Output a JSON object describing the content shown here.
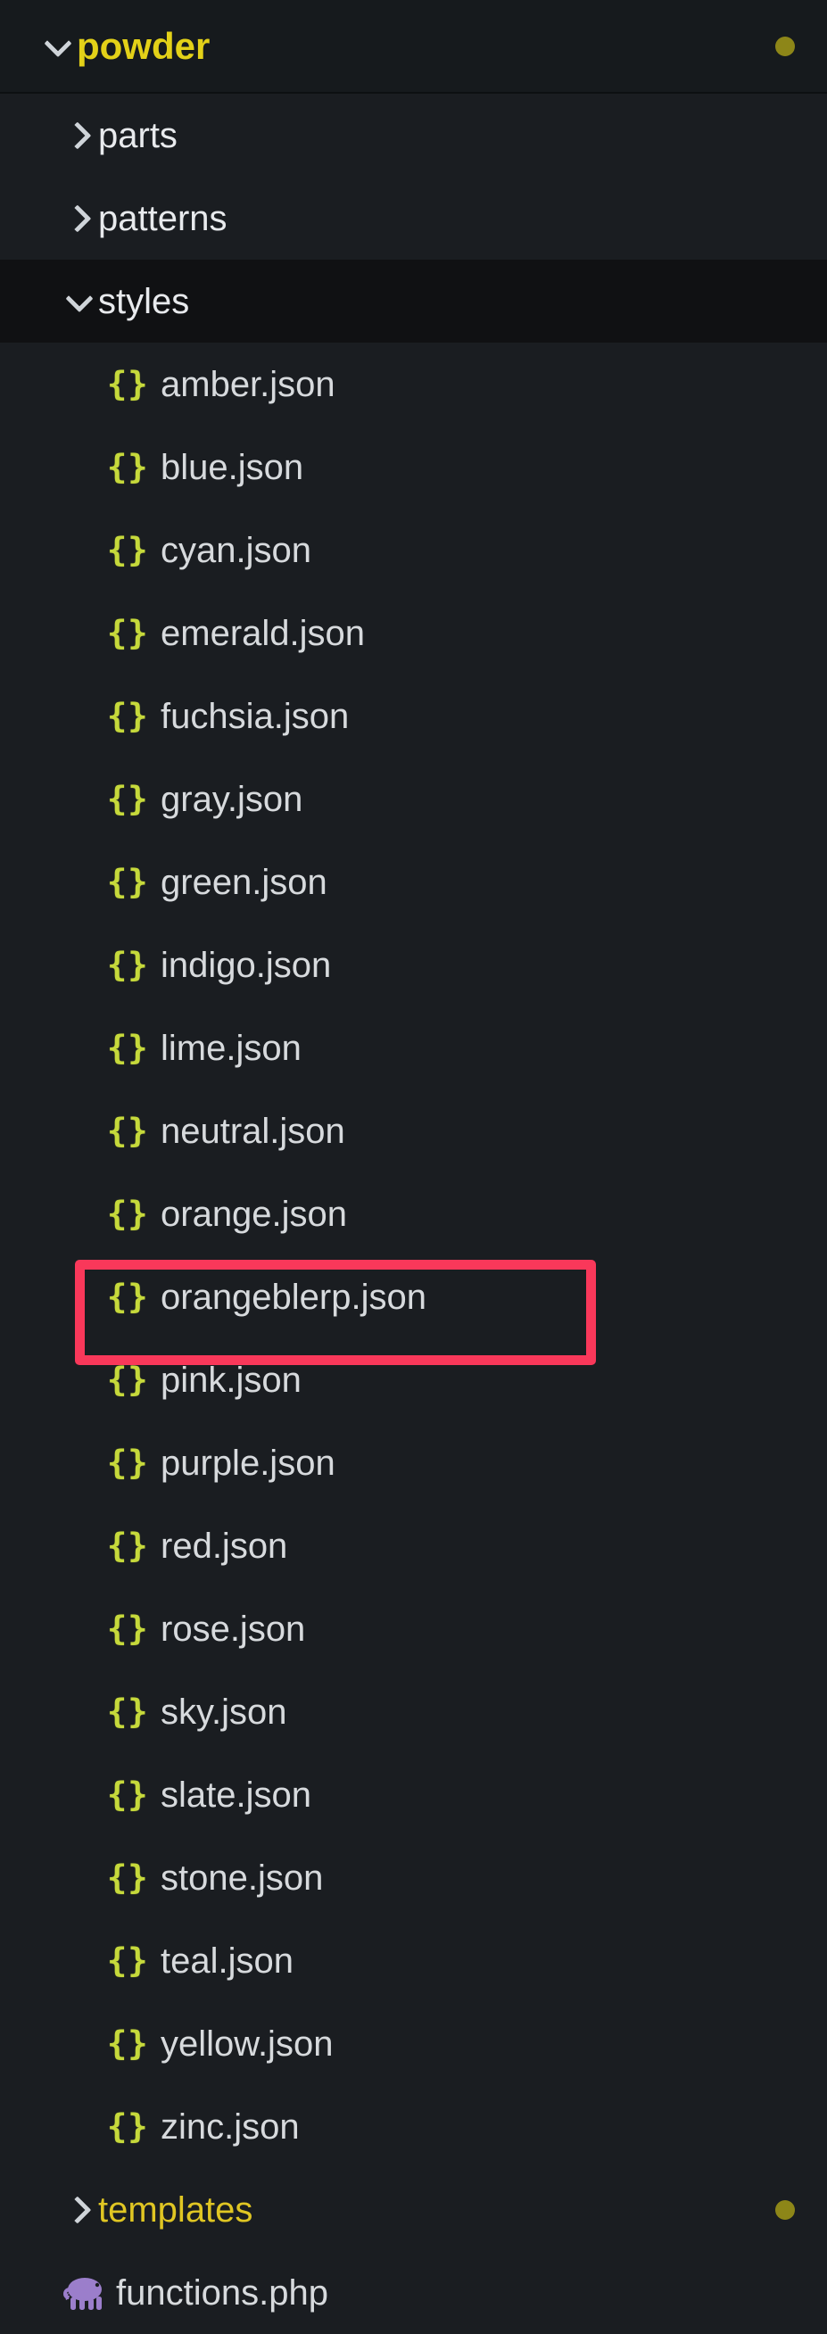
{
  "app": {
    "kind": "file-explorer-tree",
    "theme": {
      "background": "#1a1d21",
      "row_selected_background": "#101113",
      "root_row_background": "#161a1d",
      "file_text": "#d7dadd",
      "folder_text": "#e8eaed",
      "root_folder_text": "#e3d118",
      "accent_folder_text": "#e0c623",
      "json_icon": "#c6d93b",
      "php_icon": "#9b7ecb",
      "status_dot": "#8d8618",
      "annotation_border": "#f9385a"
    }
  },
  "tree": {
    "root": {
      "label": "powder",
      "icon": "chevron-down-icon",
      "expanded": true,
      "has_status_dot": true
    },
    "items": [
      {
        "label": "parts",
        "type": "folder",
        "icon": "chevron-right-icon",
        "indent": 1,
        "expanded": false,
        "dot": false,
        "selected": false
      },
      {
        "label": "patterns",
        "type": "folder",
        "icon": "chevron-right-icon",
        "indent": 1,
        "expanded": false,
        "dot": false,
        "selected": false
      },
      {
        "label": "styles",
        "type": "folder",
        "icon": "chevron-down-icon",
        "indent": 1,
        "expanded": true,
        "dot": false,
        "selected": true
      },
      {
        "label": "amber.json",
        "type": "file",
        "icon": "json-icon",
        "indent": 2,
        "dot": false,
        "selected": false
      },
      {
        "label": "blue.json",
        "type": "file",
        "icon": "json-icon",
        "indent": 2,
        "dot": false,
        "selected": false
      },
      {
        "label": "cyan.json",
        "type": "file",
        "icon": "json-icon",
        "indent": 2,
        "dot": false,
        "selected": false
      },
      {
        "label": "emerald.json",
        "type": "file",
        "icon": "json-icon",
        "indent": 2,
        "dot": false,
        "selected": false
      },
      {
        "label": "fuchsia.json",
        "type": "file",
        "icon": "json-icon",
        "indent": 2,
        "dot": false,
        "selected": false
      },
      {
        "label": "gray.json",
        "type": "file",
        "icon": "json-icon",
        "indent": 2,
        "dot": false,
        "selected": false
      },
      {
        "label": "green.json",
        "type": "file",
        "icon": "json-icon",
        "indent": 2,
        "dot": false,
        "selected": false
      },
      {
        "label": "indigo.json",
        "type": "file",
        "icon": "json-icon",
        "indent": 2,
        "dot": false,
        "selected": false
      },
      {
        "label": "lime.json",
        "type": "file",
        "icon": "json-icon",
        "indent": 2,
        "dot": false,
        "selected": false
      },
      {
        "label": "neutral.json",
        "type": "file",
        "icon": "json-icon",
        "indent": 2,
        "dot": false,
        "selected": false
      },
      {
        "label": "orange.json",
        "type": "file",
        "icon": "json-icon",
        "indent": 2,
        "dot": false,
        "selected": false
      },
      {
        "label": "orangeblerp.json",
        "type": "file",
        "icon": "json-icon",
        "indent": 2,
        "dot": false,
        "selected": false,
        "annotated": true
      },
      {
        "label": "pink.json",
        "type": "file",
        "icon": "json-icon",
        "indent": 2,
        "dot": false,
        "selected": false
      },
      {
        "label": "purple.json",
        "type": "file",
        "icon": "json-icon",
        "indent": 2,
        "dot": false,
        "selected": false
      },
      {
        "label": "red.json",
        "type": "file",
        "icon": "json-icon",
        "indent": 2,
        "dot": false,
        "selected": false
      },
      {
        "label": "rose.json",
        "type": "file",
        "icon": "json-icon",
        "indent": 2,
        "dot": false,
        "selected": false
      },
      {
        "label": "sky.json",
        "type": "file",
        "icon": "json-icon",
        "indent": 2,
        "dot": false,
        "selected": false
      },
      {
        "label": "slate.json",
        "type": "file",
        "icon": "json-icon",
        "indent": 2,
        "dot": false,
        "selected": false
      },
      {
        "label": "stone.json",
        "type": "file",
        "icon": "json-icon",
        "indent": 2,
        "dot": false,
        "selected": false
      },
      {
        "label": "teal.json",
        "type": "file",
        "icon": "json-icon",
        "indent": 2,
        "dot": false,
        "selected": false
      },
      {
        "label": "yellow.json",
        "type": "file",
        "icon": "json-icon",
        "indent": 2,
        "dot": false,
        "selected": false
      },
      {
        "label": "zinc.json",
        "type": "file",
        "icon": "json-icon",
        "indent": 2,
        "dot": false,
        "selected": false
      },
      {
        "label": "templates",
        "type": "folder",
        "icon": "chevron-right-icon",
        "indent": 1,
        "expanded": false,
        "dot": true,
        "selected": false,
        "accent": true
      },
      {
        "label": "functions.php",
        "type": "file",
        "icon": "php-elephant-icon",
        "indent": 1,
        "dot": false,
        "selected": false
      }
    ]
  },
  "icons": {
    "json_glyph": "{}",
    "chevron_right": "chevron-right-icon",
    "chevron_down": "chevron-down-icon",
    "php_elephant": "php-elephant-icon"
  }
}
